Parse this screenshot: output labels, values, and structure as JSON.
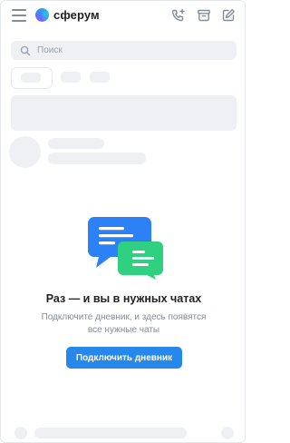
{
  "app": {
    "name": "сферум",
    "colors": {
      "accent": "#2688eb",
      "skeleton": "#eef0f3",
      "muted": "#818c99",
      "text": "#222222",
      "bubble_blue": "#2d81f7",
      "bubble_green": "#2fd07f"
    }
  },
  "header": {
    "icons": [
      "menu-icon",
      "call-add-icon",
      "archive-icon",
      "compose-icon"
    ]
  },
  "search": {
    "placeholder": "Поиск"
  },
  "empty_state": {
    "title": "Раз — и вы в нужных чатах",
    "subtitle": "Подключите дневник, и здесь появятся все нужные чаты",
    "button_label": "Подключить дневник",
    "illustration": "chat-bubbles-icon"
  }
}
